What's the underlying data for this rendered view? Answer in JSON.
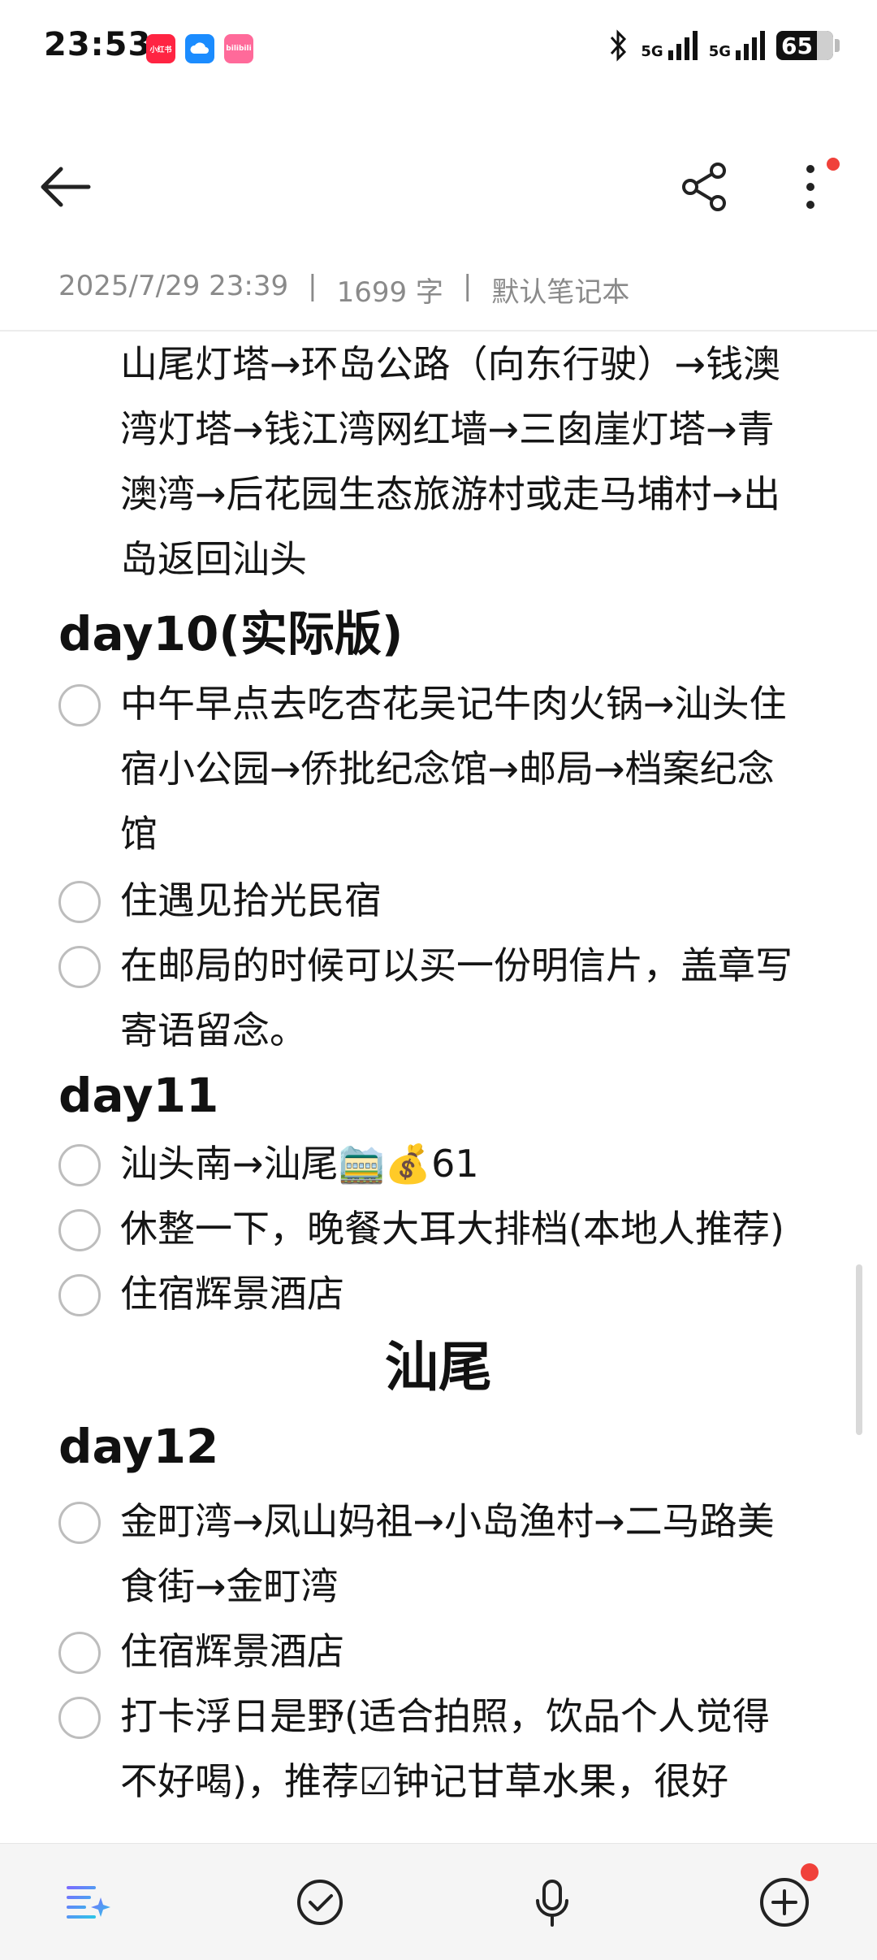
{
  "status_bar": {
    "time": "23:53",
    "app_badges": [
      "小红书",
      "",
      "bilibili"
    ],
    "network1": "5G",
    "network2": "5G",
    "battery": "65"
  },
  "app_bar": {
    "back_icon": "back-arrow-icon",
    "share_icon": "share-icon",
    "more_icon": "more-vertical-icon"
  },
  "meta": {
    "datetime": "2025/7/29 23:39",
    "sep1": "|",
    "word_count": "1699 字",
    "sep2": "|",
    "notebook": "默认笔记本"
  },
  "content": {
    "intro_lines": [
      "山尾灯塔→环岛公路（向东行驶）→钱澳",
      "湾灯塔→钱江湾网红墙→三囱崖灯塔→青",
      "澳湾→后花园生态旅游村或走马埔村→出",
      "岛返回汕头"
    ],
    "day10": {
      "heading": "day10(实际版)",
      "items": [
        {
          "lines": [
            "中午早点去吃杏花吴记牛肉火锅→汕头住",
            "宿小公园→侨批纪念馆→邮局→档案纪念",
            "馆"
          ]
        },
        {
          "lines": [
            "住遇见拾光民宿"
          ]
        },
        {
          "lines": [
            "在邮局的时候可以买一份明信片，盖章写",
            "寄语留念。"
          ]
        }
      ]
    },
    "day11": {
      "heading": "day11",
      "items": [
        {
          "lines": [
            "汕头南→汕尾🚞💰61"
          ]
        },
        {
          "lines": [
            "休整一下，晚餐大耳大排档(本地人推荐)"
          ]
        },
        {
          "lines": [
            "住宿辉景酒店"
          ]
        }
      ]
    },
    "section_title": "汕尾",
    "day12": {
      "heading": "day12",
      "items": [
        {
          "lines": [
            "金町湾→凤山妈祖→小岛渔村→二马路美",
            "食街→金町湾"
          ]
        },
        {
          "lines": [
            "住宿辉景酒店"
          ]
        },
        {
          "lines": [
            "打卡浮日是野(适合拍照，饮品个人觉得",
            "不好喝)，推荐☑钟记甘草水果，很好"
          ]
        }
      ]
    }
  },
  "toolbar": {
    "tools": [
      "ai-sparkle-icon",
      "checklist-icon",
      "microphone-icon",
      "add-icon"
    ]
  }
}
